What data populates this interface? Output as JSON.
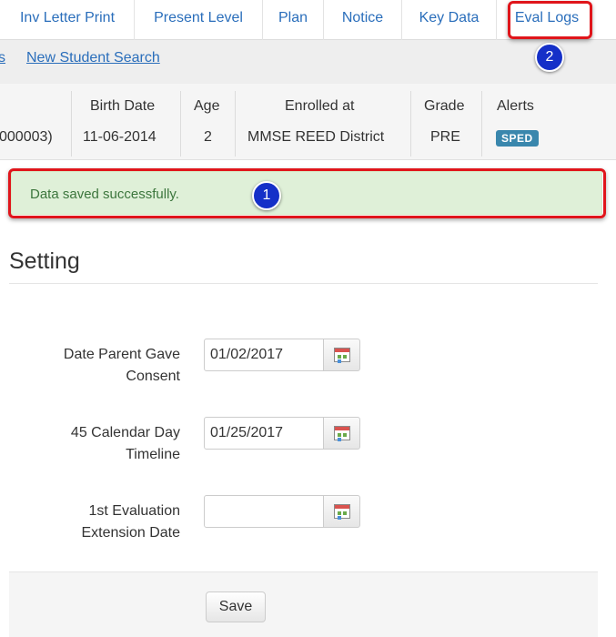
{
  "nav": {
    "tabs": [
      "Inv Letter Print",
      "Present Level",
      "Plan",
      "Notice",
      "Key Data",
      "Eval Logs"
    ],
    "sub_links": [
      "s",
      "New Student Search"
    ]
  },
  "student": {
    "headers": [
      "Birth Date",
      "Age",
      "Enrolled at",
      "Grade",
      "Alerts"
    ],
    "id_fragment": "000003)",
    "values": [
      "11-06-2014",
      "2",
      "MMSE REED District",
      "PRE"
    ],
    "badge": "SPED"
  },
  "alert": {
    "message": "Data saved successfully."
  },
  "callouts": [
    "1",
    "2"
  ],
  "section": {
    "title": "Setting"
  },
  "fields": [
    {
      "label_line1": "Date Parent Gave",
      "label_line2": "Consent",
      "value": "01/02/2017"
    },
    {
      "label_line1": "45 Calendar Day",
      "label_line2": "Timeline",
      "value": "01/25/2017"
    },
    {
      "label_line1": "1st Evaluation",
      "label_line2": "Extension Date",
      "value": ""
    }
  ],
  "actions": {
    "save": "Save"
  },
  "colors": {
    "link": "#2a6ebb",
    "highlight": "#e0151b",
    "success_bg": "#dff0d8",
    "success_text": "#3c763d",
    "badge": "#3a87ad"
  }
}
